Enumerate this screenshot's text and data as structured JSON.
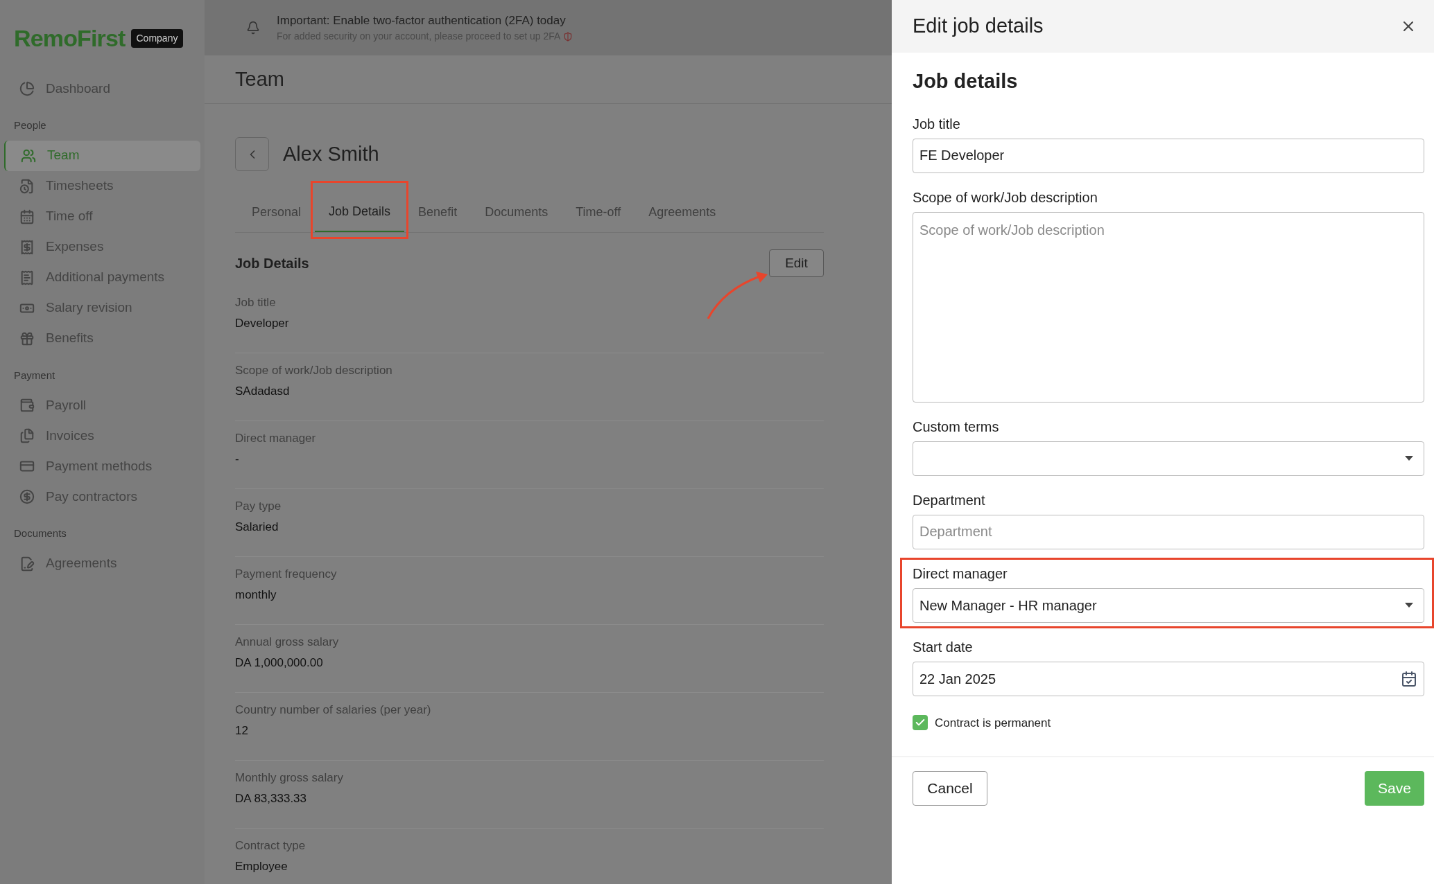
{
  "sidebar": {
    "logo": "RemoFirst",
    "badge": "Company",
    "top_items": [
      {
        "label": "Dashboard",
        "selected": false
      }
    ],
    "sections": [
      {
        "title": "People",
        "items": [
          {
            "label": "Team",
            "selected": true
          },
          {
            "label": "Timesheets",
            "selected": false
          },
          {
            "label": "Time off",
            "selected": false
          },
          {
            "label": "Expenses",
            "selected": false
          },
          {
            "label": "Additional payments",
            "selected": false
          },
          {
            "label": "Salary revision",
            "selected": false
          },
          {
            "label": "Benefits",
            "selected": false
          }
        ]
      },
      {
        "title": "Payment",
        "items": [
          {
            "label": "Payroll",
            "selected": false
          },
          {
            "label": "Invoices",
            "selected": false
          },
          {
            "label": "Payment methods",
            "selected": false
          },
          {
            "label": "Pay contractors",
            "selected": false
          }
        ]
      },
      {
        "title": "Documents",
        "items": [
          {
            "label": "Agreements",
            "selected": false
          }
        ]
      }
    ]
  },
  "banner": {
    "title": "Important: Enable two-factor authentication (2FA) today",
    "text": "For added security on your account, please proceed to set up 2FA"
  },
  "page": {
    "title": "Team",
    "person": "Alex Smith",
    "tabs": [
      {
        "label": "Personal",
        "selected": false,
        "highlighted": false
      },
      {
        "label": "Job Details",
        "selected": true,
        "highlighted": true
      },
      {
        "label": "Benefit",
        "selected": false,
        "highlighted": false
      },
      {
        "label": "Documents",
        "selected": false,
        "highlighted": false
      },
      {
        "label": "Time-off",
        "selected": false,
        "highlighted": false
      },
      {
        "label": "Agreements",
        "selected": false,
        "highlighted": false
      }
    ],
    "section_title": "Job Details",
    "edit_button": "Edit",
    "fields": [
      {
        "label": "Job title",
        "value": "Developer"
      },
      {
        "label": "Scope of work/Job description",
        "value": "SAdadasd"
      },
      {
        "label": "Direct manager",
        "value": "-"
      },
      {
        "label": "Pay type",
        "value": "Salaried"
      },
      {
        "label": "Payment frequency",
        "value": "monthly"
      },
      {
        "label": "Annual gross salary",
        "value": "DA 1,000,000.00"
      },
      {
        "label": "Country number of salaries (per year)",
        "value": "12"
      },
      {
        "label": "Monthly gross salary",
        "value": "DA 83,333.33"
      },
      {
        "label": "Contract type",
        "value": "Employee"
      }
    ]
  },
  "panel": {
    "title": "Edit job details",
    "heading": "Job details",
    "fields": [
      {
        "kind": "text",
        "label": "Job title",
        "value": "FE Developer",
        "highlighted": false
      },
      {
        "kind": "textarea",
        "label": "Scope of work/Job description",
        "placeholder": "Scope of work/Job description",
        "highlighted": false
      },
      {
        "kind": "select",
        "label": "Custom terms",
        "highlighted": false
      },
      {
        "kind": "text",
        "label": "Department",
        "placeholder": "Department",
        "highlighted": false
      },
      {
        "kind": "select",
        "label": "Direct manager",
        "value": "New Manager - HR manager",
        "highlighted": true
      },
      {
        "kind": "date",
        "label": "Start date",
        "value": "22 Jan 2025",
        "highlighted": false
      }
    ],
    "checkbox": {
      "label": "Contract is permanent",
      "checked": true
    },
    "cancel": "Cancel",
    "save": "Save"
  }
}
